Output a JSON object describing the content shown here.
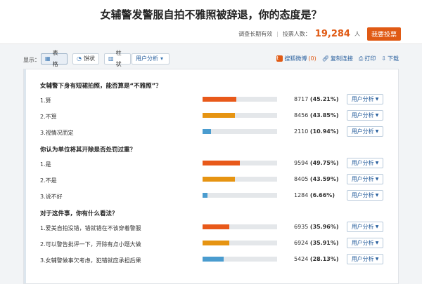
{
  "header": {
    "title": "女辅警发警服自拍不雅照被辞退，你的态度是？",
    "survey_note": "调查长期有效",
    "voters_label": "投票人数：",
    "voters_count": "19,284",
    "voters_unit": "人",
    "vote_button": "我要投票"
  },
  "toolbar": {
    "display_label": "显示：",
    "views": [
      {
        "label": "表格",
        "icon": "table-icon",
        "active": true
      },
      {
        "label": "饼状",
        "icon": "pie-icon",
        "active": false
      },
      {
        "label": "柱状",
        "icon": "bar-icon",
        "active": false
      }
    ],
    "user_analysis": "用户分析",
    "share_weibo": "搜狐微博",
    "share_count": "(0)",
    "copy_link": "复制连接",
    "print": "打印",
    "download": "下载"
  },
  "colors": {
    "accent": "#e05a14",
    "fill_orange": "#e8591a",
    "fill_amber": "#e69412",
    "fill_blue": "#4a9ccf"
  },
  "questions": [
    {
      "title": "女辅警下身有短裙拍照，能否算是“不雅照”？",
      "options": [
        {
          "label": "1.算",
          "count": "8717",
          "pct": "(45.21%)",
          "fraction": 0.4521,
          "color": "#e8591a"
        },
        {
          "label": "2.不算",
          "count": "8456",
          "pct": "(43.85%)",
          "fraction": 0.4385,
          "color": "#e69412"
        },
        {
          "label": "3.视情况而定",
          "count": "2110",
          "pct": "(10.94%)",
          "fraction": 0.1094,
          "color": "#4a9ccf"
        }
      ]
    },
    {
      "title": "你认为单位将其开除是否处罚过重？",
      "options": [
        {
          "label": "1.是",
          "count": "9594",
          "pct": "(49.75%)",
          "fraction": 0.4975,
          "color": "#e8591a"
        },
        {
          "label": "2.不是",
          "count": "8405",
          "pct": "(43.59%)",
          "fraction": 0.4359,
          "color": "#e69412"
        },
        {
          "label": "3.说不好",
          "count": "1284",
          "pct": "(6.66%)",
          "fraction": 0.0666,
          "color": "#4a9ccf"
        }
      ]
    },
    {
      "title": "对于这件事，你有什么看法？",
      "options": [
        {
          "label": "1.爱美自拍没错，错就错在不该穿着警服",
          "count": "6935",
          "pct": "(35.96%)",
          "fraction": 0.3596,
          "color": "#e8591a"
        },
        {
          "label": "2.可以警告批评一下，开除有点小题大做",
          "count": "6924",
          "pct": "(35.91%)",
          "fraction": 0.3591,
          "color": "#e69412"
        },
        {
          "label": "3.女辅警做事欠考虑，犯错就应承担后果",
          "count": "5424",
          "pct": "(28.13%)",
          "fraction": 0.2813,
          "color": "#4a9ccf"
        }
      ]
    }
  ]
}
